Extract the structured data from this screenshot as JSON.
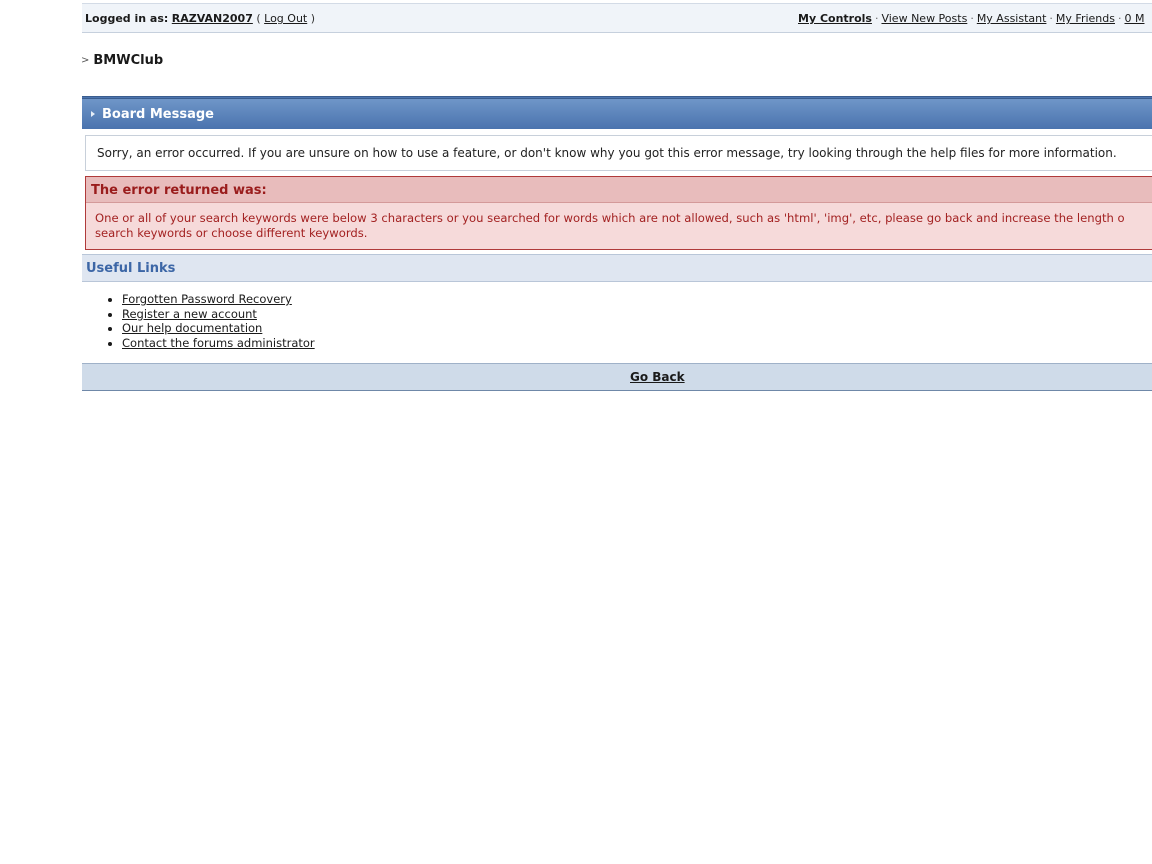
{
  "userbar": {
    "logged_in_label": "Logged in as:",
    "username": "RAZVAN2007",
    "paren_open": "(",
    "logout_label": "Log Out",
    "paren_close": ")",
    "links": {
      "my_controls": "My Controls",
      "view_new_posts": "View New Posts",
      "my_assistant": "My Assistant",
      "my_friends": "My Friends",
      "messages_partial": "0 M"
    },
    "separator": "·"
  },
  "breadcrumb": {
    "arrow": ">",
    "forum_name": "BMWClub"
  },
  "board_message": {
    "title": "Board Message",
    "info_text": "Sorry, an error occurred. If you are unsure on how to use a feature, or don't know why you got this error message, try looking through the help files for more information."
  },
  "error": {
    "title": "The error returned was:",
    "line1": "One or all of your search keywords were below 3 characters or you searched for words which are not allowed, such as 'html', 'img', etc, please go back and increase the length o",
    "line2": "search keywords or choose different keywords."
  },
  "useful_links": {
    "title": "Useful Links",
    "items": [
      "Forgotten Password Recovery",
      "Register a new account",
      "Our help documentation",
      "Contact the forums administrator"
    ]
  },
  "go_back": {
    "label": "Go Back"
  }
}
